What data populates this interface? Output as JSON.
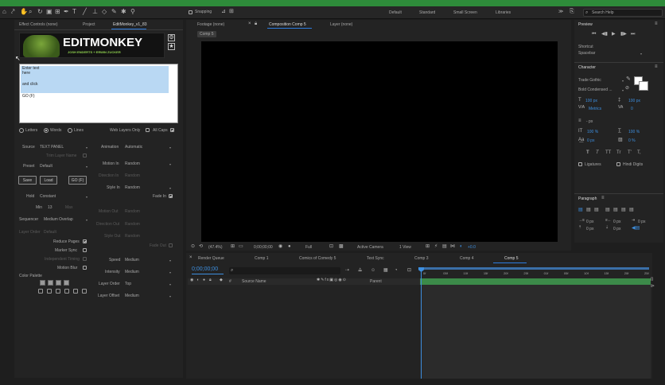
{
  "colors": {
    "accent_green": "#2e8b3a",
    "blue": "#3d8fe0",
    "panel": "#232323",
    "bg": "#1e1e1e",
    "highlight_blue": "#b9d8f3"
  },
  "top_toolbar": {
    "snapping": "Snapping",
    "workspaces": [
      "Default",
      "Standard",
      "Small Screen",
      "Libraries"
    ],
    "search_placeholder": "Search Help"
  },
  "left_panel": {
    "tabs": [
      "Effect Controls (none)",
      "Project",
      "EditMonkey_v1_83"
    ],
    "logo": {
      "title": "EDITMONKEY",
      "subtitle": "JOSH ENDERTS + ERWIN ZUCKER"
    },
    "text_area_lines": [
      "Enter text",
      "here",
      "",
      "and click",
      "",
      "GO (F)"
    ],
    "split_mode": {
      "options": [
        "Letters",
        "Words",
        "Lines"
      ],
      "selected": "Words"
    },
    "web_layers_only": "Web Layers Only",
    "all_caps": "All Caps",
    "source_label": "Source",
    "source_value": "TEXT PANEL",
    "trim_layer_name": "Trim Layer Name",
    "preset_label": "Preset",
    "preset_value": "Default",
    "buttons": [
      "Save",
      "Load",
      "GO (F)"
    ],
    "hold_label": "Hold",
    "hold_value": "Constant",
    "min_label": "Min",
    "min_value": "13",
    "max_label": "Max",
    "sequencer_label": "Sequencer",
    "sequencer_value": "Medium Overlap",
    "layer_order_label": "Layer Order",
    "layer_order_value": "Default",
    "checks": [
      "Reduce Pages",
      "Marker Sync",
      "Independent Timing",
      "Motion Blur"
    ],
    "color_palette": "Color Palette",
    "animation_label": "Animation",
    "animation_value": "Automatic",
    "motion_in_label": "Motion In",
    "motion_in_value": "Random",
    "direction_in_label": "Direction In",
    "direction_in_value": "Random",
    "style_in_label": "Style In",
    "style_in_value": "Random",
    "fade_in": "Fade In",
    "motion_out_label": "Motion Out",
    "motion_out_value": "Random",
    "direction_out_label": "Direction Out",
    "direction_out_value": "Random",
    "style_out_label": "Style Out",
    "style_out_value": "Random",
    "fade_out": "Fade Out",
    "speed_label": "Speed",
    "speed_value": "Medium",
    "intensity_label": "Intensity",
    "intensity_value": "Medium",
    "layer_order2_label": "Layer Order",
    "layer_order2_value": "Top",
    "layer_offset_label": "Layer Offset",
    "layer_offset_value": "Medium"
  },
  "center": {
    "tabs": [
      "Footage (none)",
      "Composition Comp 5",
      "Layer (none)"
    ],
    "comp_tab": "Comp 5",
    "viewer_bar": {
      "zoom": "(47.4%)",
      "time": "0;00;00;00",
      "resolution": "Full",
      "camera": "Active Camera",
      "views": "1 View",
      "exposure": "+0.0"
    }
  },
  "timeline": {
    "tabs": [
      "Render Queue",
      "Comp 1",
      "Comics of Comedy 5",
      "Text Sync",
      "Comp 3",
      "Comp 4",
      "Comp 5"
    ],
    "timecode": "0;00;00;00",
    "columns": {
      "source_name": "Source Name",
      "parent": "Parent"
    },
    "ruler": [
      "0f",
      "05f",
      "10f",
      "15f",
      "20f",
      "25f",
      "01f",
      "05f",
      "10f",
      "15f",
      "20f",
      "25f"
    ]
  },
  "right_panel": {
    "preview_title": "Preview",
    "shortcut_label": "Shortcut",
    "shortcut_value": "Spacebar",
    "character_title": "Character",
    "font_family": "Trade Gothic",
    "font_style": "Bold Condensed ...",
    "size": "100 px",
    "leading": "100 px",
    "kerning": "Metrics",
    "tracking": "0",
    "stroke": "- px",
    "vscale": "100 %",
    "hscale": "100 %",
    "baseline": "0 px",
    "tsume": "0 %",
    "styles": [
      "T",
      "T",
      "TT",
      "Tr",
      "T'",
      "T,"
    ],
    "ligatures": "Ligatures",
    "hindi_digits": "Hindi Digits",
    "paragraph_title": "Paragraph",
    "para_values": [
      "0 px",
      "0 px",
      "0 px",
      "0 px",
      "0 px"
    ]
  }
}
